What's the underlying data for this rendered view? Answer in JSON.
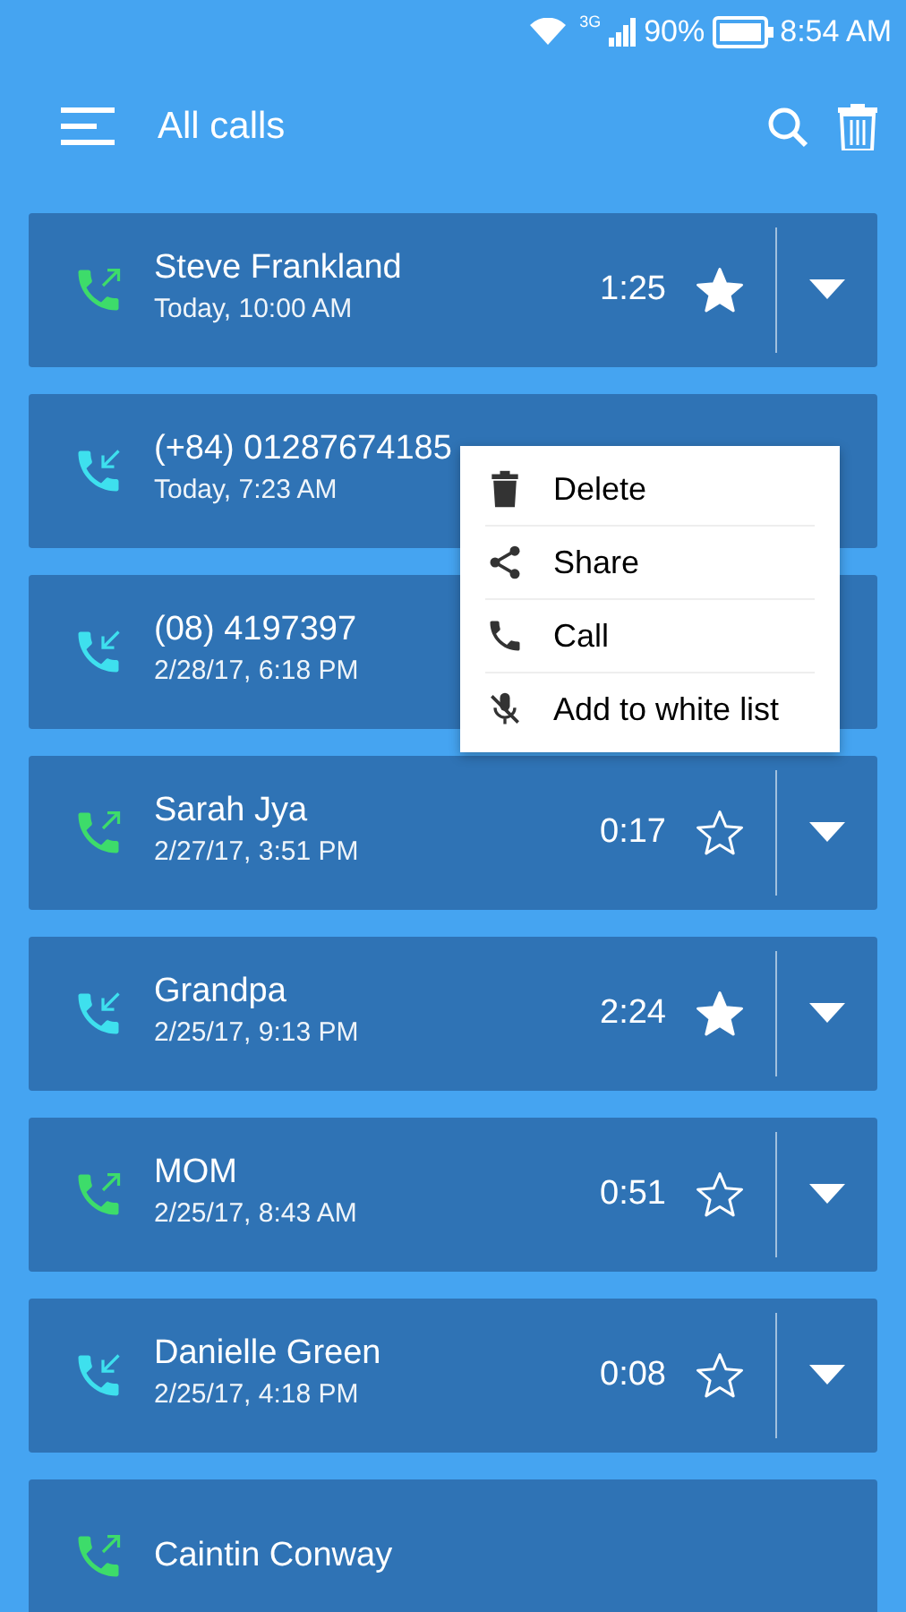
{
  "status_bar": {
    "network": "3G",
    "battery": "90%",
    "time": "8:54 AM"
  },
  "header": {
    "title": "All calls"
  },
  "calls": [
    {
      "kind": "outgoing",
      "name": "Steve Frankland",
      "time": "Today, 10:00 AM",
      "duration": "1:25",
      "starred": true
    },
    {
      "kind": "incoming",
      "name": "(+84) 01287674185",
      "time": "Today, 7:23 AM"
    },
    {
      "kind": "incoming",
      "name": "(08) 4197397",
      "time": "2/28/17, 6:18 PM"
    },
    {
      "kind": "outgoing",
      "name": "Sarah Jya",
      "time": "2/27/17, 3:51 PM",
      "duration": "0:17",
      "starred": false
    },
    {
      "kind": "incoming",
      "name": "Grandpa",
      "time": "2/25/17, 9:13 PM",
      "duration": "2:24",
      "starred": true
    },
    {
      "kind": "outgoing",
      "name": "MOM",
      "time": "2/25/17, 8:43 AM",
      "duration": "0:51",
      "starred": false
    },
    {
      "kind": "incoming",
      "name": "Danielle Green",
      "time": "2/25/17, 4:18 PM",
      "duration": "0:08",
      "starred": false
    },
    {
      "kind": "outgoing",
      "name": "Caintin Conway"
    }
  ],
  "context_menu": {
    "items": [
      {
        "kind": "delete",
        "label": "Delete"
      },
      {
        "kind": "share",
        "label": "Share"
      },
      {
        "kind": "call",
        "label": "Call"
      },
      {
        "kind": "mic-off",
        "label": "Add to white list"
      }
    ]
  }
}
